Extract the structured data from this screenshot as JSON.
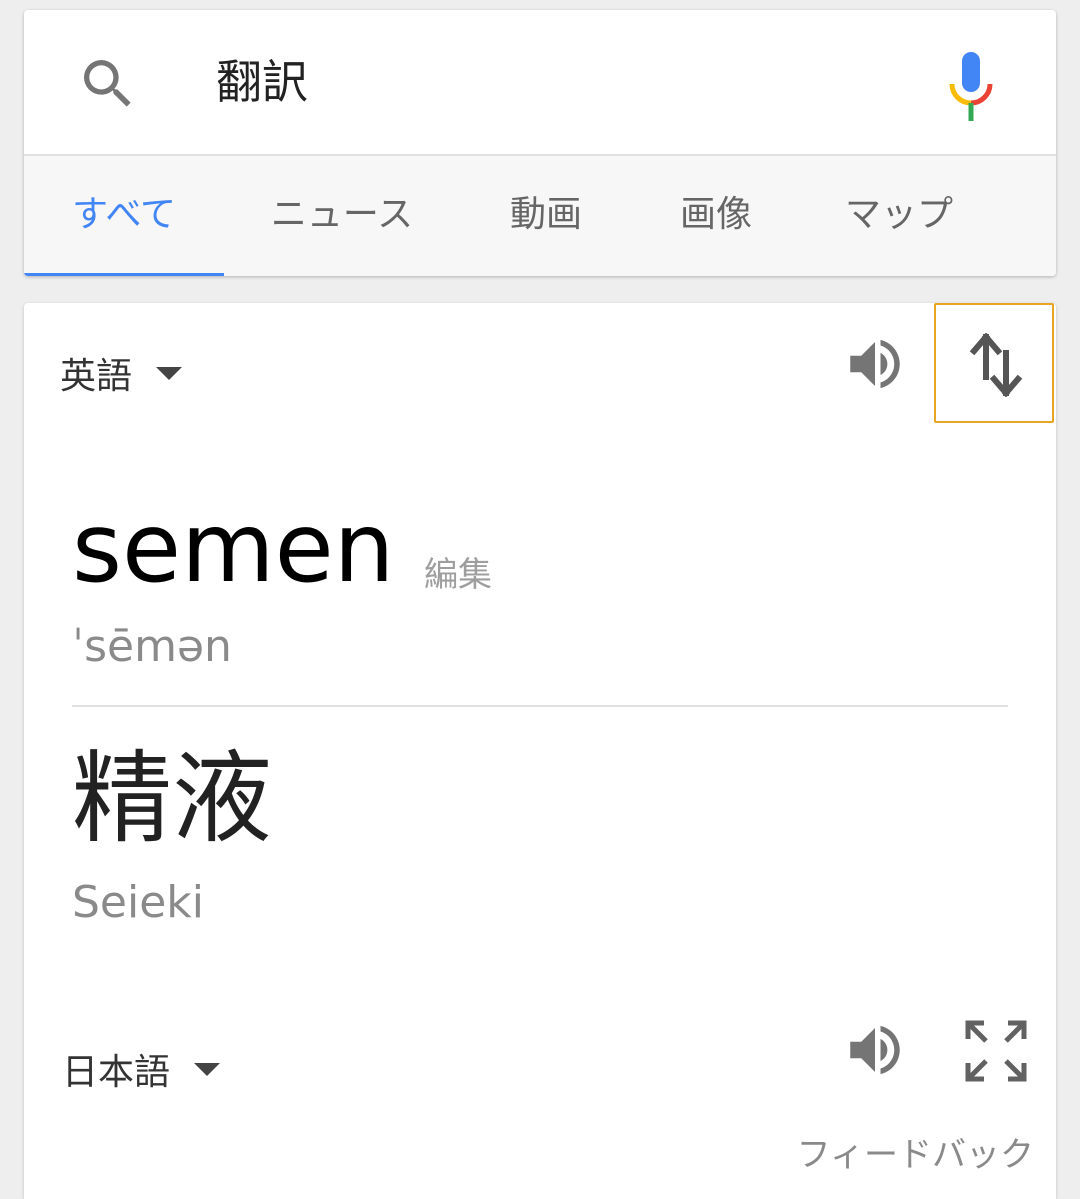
{
  "search": {
    "query": "翻訳"
  },
  "tabs": [
    {
      "label": "すべて",
      "active": true
    },
    {
      "label": "ニュース",
      "active": false
    },
    {
      "label": "動画",
      "active": false
    },
    {
      "label": "画像",
      "active": false
    },
    {
      "label": "マップ",
      "active": false
    }
  ],
  "translate": {
    "source_language": "英語",
    "source_text": "semen",
    "edit_label": "編集",
    "pronunciation": "ˈsēmən",
    "target_language": "日本語",
    "target_text": "精液",
    "romanization": "Seieki",
    "feedback_label": "フィードバック"
  },
  "icons": {
    "search": "search-icon",
    "mic": "mic-icon",
    "speaker": "speaker-icon",
    "swap": "swap-languages-icon",
    "expand": "fullscreen-icon"
  },
  "colors": {
    "accent": "#4285f4",
    "focus_outline": "#e8a524"
  }
}
